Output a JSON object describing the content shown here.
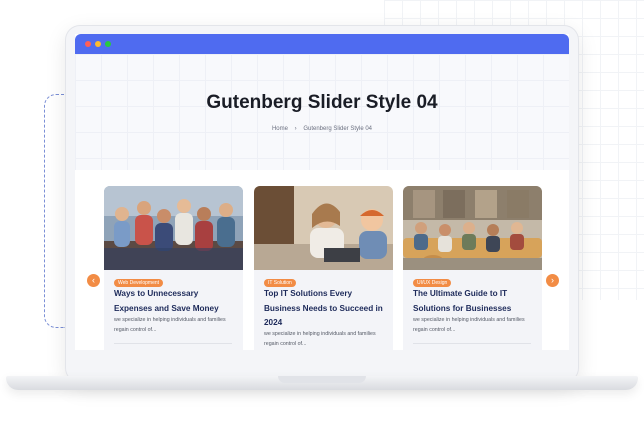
{
  "page": {
    "title": "Gutenberg Slider Style 04",
    "breadcrumb": {
      "home": "Home",
      "separator": "›",
      "current": "Gutenberg Slider Style 04"
    }
  },
  "colors": {
    "browser_bar": "#4f6bf0",
    "accent": "#f28c45",
    "title_text": "#1d2a5a"
  },
  "slider": {
    "prev_icon": "chevron-left-icon",
    "next_icon": "chevron-right-icon",
    "cards": [
      {
        "category": "Web Development",
        "title": "Ways to Unnecessary Expenses and Save Money",
        "excerpt": "we specialize in helping individuals and families regain control of..."
      },
      {
        "category": "IT Solution",
        "title": "Top IT Solutions Every Business Needs to Succeed in 2024",
        "excerpt": "we specialize in helping individuals and families regain control of..."
      },
      {
        "category": "UI/UX Design",
        "title": "The Ultimate Guide to IT Solutions for Businesses",
        "excerpt": "we specialize in helping individuals and families regain control of..."
      }
    ]
  }
}
